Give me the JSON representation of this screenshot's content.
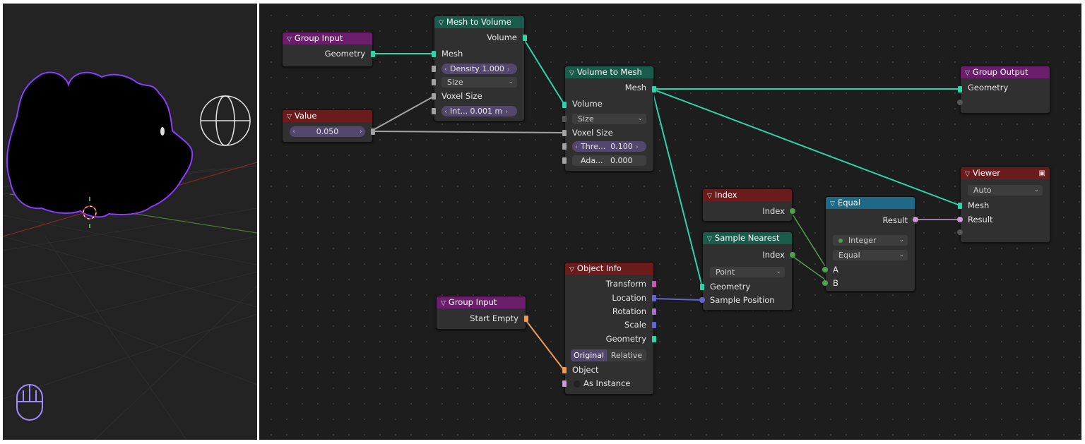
{
  "icons": {
    "chevron": "chevron-down-icon",
    "viewer": "monitor-icon",
    "viewport_nav": "gizmo-icon",
    "mouse": "mouse-icon"
  },
  "colors": {
    "geometry_wire": "#2ed3a6",
    "float_wire": "#a3a3a3",
    "integer_wire": "#4f9f4f",
    "vector_wire": "#6464d0",
    "object_wire": "#ee9a54",
    "boolean_wire": "#c99ad6",
    "selection_outline": "#8a3cff"
  },
  "nodes": {
    "group_input_1": {
      "title": "Group Input",
      "out_geometry": "Geometry"
    },
    "value": {
      "title": "Value",
      "value": "0.050"
    },
    "mesh_to_volume": {
      "title": "Mesh to Volume",
      "out_volume": "Volume",
      "in_mesh": "Mesh",
      "density_label": "Density",
      "density_value": "1.000",
      "resolution_mode": "Size",
      "voxel_size": "Voxel Size",
      "interior_label": "Int...",
      "interior_value": "0.001 m"
    },
    "volume_to_mesh": {
      "title": "Volume to Mesh",
      "out_mesh": "Mesh",
      "in_volume": "Volume",
      "resolution_mode": "Size",
      "voxel_size": "Voxel Size",
      "threshold_label": "Thre...",
      "threshold_value": "0.100",
      "adaptivity_label": "Ada...",
      "adaptivity_value": "0.000"
    },
    "group_output": {
      "title": "Group Output",
      "in_geometry": "Geometry"
    },
    "viewer": {
      "title": "Viewer",
      "domain": "Auto",
      "in_mesh": "Mesh",
      "in_result": "Result"
    },
    "index": {
      "title": "Index",
      "out_index": "Index"
    },
    "equal": {
      "title": "Equal",
      "out_result": "Result",
      "data_type": "Integer",
      "operation": "Equal",
      "in_a": "A",
      "in_b": "B"
    },
    "sample_nearest": {
      "title": "Sample Nearest",
      "out_index": "Index",
      "domain": "Point",
      "in_geometry": "Geometry",
      "in_sample_position": "Sample Position"
    },
    "object_info": {
      "title": "Object Info",
      "out_transform": "Transform",
      "out_location": "Location",
      "out_rotation": "Rotation",
      "out_scale": "Scale",
      "out_geometry": "Geometry",
      "mode_original": "Original",
      "mode_relative": "Relative",
      "in_object": "Object",
      "in_as_instance": "As Instance"
    },
    "group_input_2": {
      "title": "Group Input",
      "out_start_empty": "Start Empty"
    }
  }
}
